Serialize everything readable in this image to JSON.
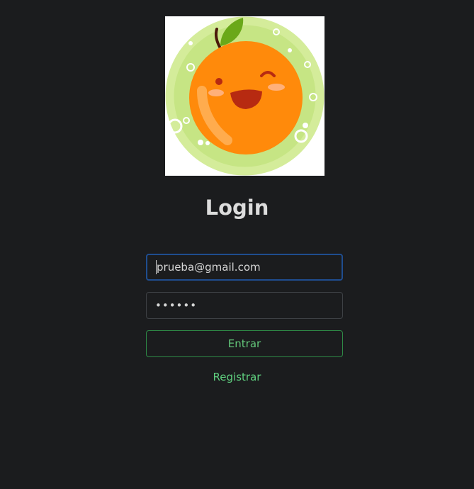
{
  "logo": {
    "icon": "smiling-orange-icon",
    "colors": {
      "background": "#ffffff",
      "ring": "#d4ec9a",
      "orange": "#ff8a0b",
      "leaf": "#6aa819",
      "mouth": "#b72a11"
    }
  },
  "login": {
    "title": "Login",
    "email_value": "prueba@gmail.com",
    "password_value": "••••••",
    "submit_label": "Entrar",
    "register_label": "Registrar"
  },
  "colors": {
    "page_background": "#1b1c1e",
    "input_focus_border": "#1f4d8f",
    "button_border": "#2e8b46",
    "button_text": "#63c77a",
    "link_text": "#5fcf7f"
  }
}
